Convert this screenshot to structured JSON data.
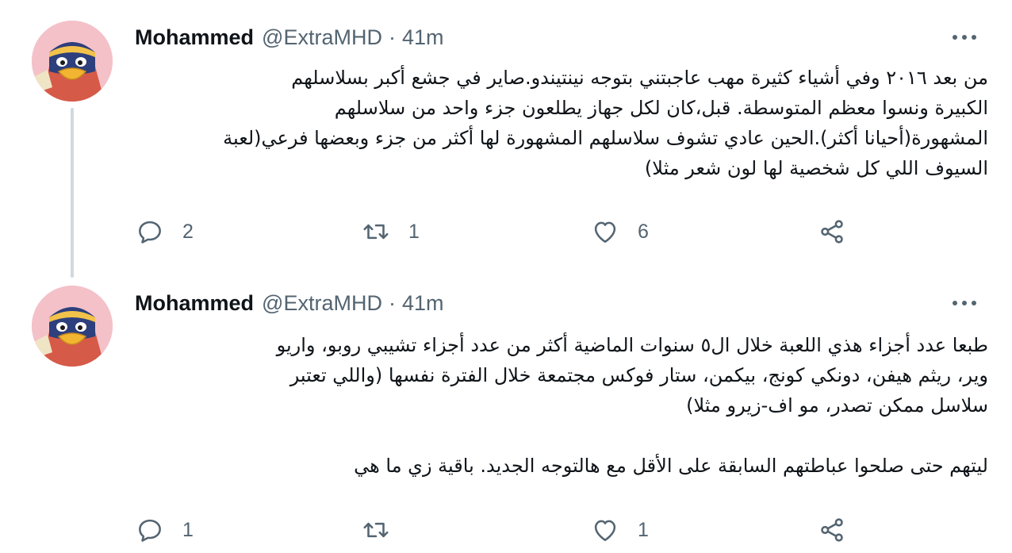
{
  "colors": {
    "text_primary": "#0f1419",
    "text_secondary": "#536471",
    "thread_line": "#cfd9de",
    "background": "#ffffff"
  },
  "tweets": [
    {
      "author_name": "Mohammed",
      "handle": "@ExtraMHD",
      "separator": "·",
      "time": "41m",
      "avatar_icon": "cartoon-penguin-avatar",
      "lines": [
        "من بعد ٢٠١٦ وفي أشياء كثيرة مهب عاجبتني بتوجه نينتيندو.صاير في جشع أكبر بسلاسلهم",
        "الكبيرة ونسوا معظم المتوسطة. قبل،كان لكل جهاز يطلعون جزء واحد من سلاسلهم",
        "المشهورة(أحيانا أكثر).الحين عادي تشوف سلاسلهم المشهورة لها أكثر من جزء وبعضها فرعي(لعبة",
        "السيوف اللي كل شخصية لها لون شعر مثلا)"
      ],
      "reply_count": "2",
      "retweet_count": "1",
      "like_count": "6"
    },
    {
      "author_name": "Mohammed",
      "handle": "@ExtraMHD",
      "separator": "·",
      "time": "41m",
      "avatar_icon": "cartoon-penguin-avatar",
      "lines": [
        "طبعا عدد أجزاء هذي اللعبة خلال ال٥ سنوات الماضية أكثر من عدد أجزاء تشيبي روبو، واريو",
        "وير، ريثم هيفن، دونكي كونج، بيكمن، ستار فوكس مجتمعة خلال الفترة نفسها (واللي تعتبر",
        "سلاسل ممكن تصدر، مو اف-زيرو مثلا)",
        "ليتهم حتى صلحوا عباطتهم السابقة على الأقل مع هالتوجه الجديد. باقية زي ما هي"
      ],
      "reply_count": "1",
      "retweet_count": "",
      "like_count": "1"
    }
  ]
}
